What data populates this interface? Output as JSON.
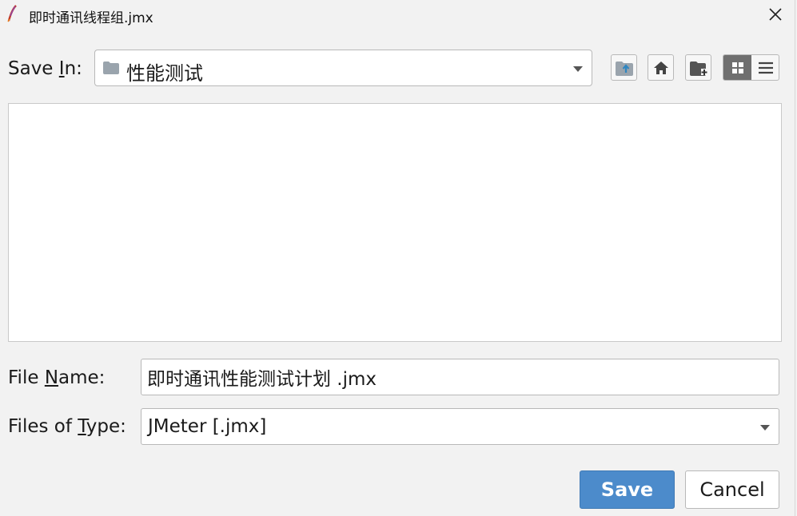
{
  "window": {
    "title": "即时通讯线程组.jmx",
    "app_icon": "feather-icon",
    "close_icon": "close-icon"
  },
  "save_in": {
    "label_prefix": "Save ",
    "label_mnemonic": "I",
    "label_suffix": "n:",
    "folder_icon": "folder-icon",
    "current": "性能测试"
  },
  "toolbar": {
    "up_folder_icon": "up-folder-icon",
    "home_icon": "home-icon",
    "new_folder_icon": "new-folder-icon",
    "list_view_icon": "grid-view-icon",
    "details_view_icon": "details-view-icon"
  },
  "file_name": {
    "label_prefix": "File ",
    "label_mnemonic": "N",
    "label_suffix": "ame:",
    "value": "即时通讯性能测试计划 .jmx"
  },
  "file_type": {
    "label_prefix": "Files of ",
    "label_mnemonic": "T",
    "label_suffix": "ype:",
    "selected": "JMeter [.jmx]"
  },
  "buttons": {
    "save": "Save",
    "cancel": "Cancel"
  },
  "colors": {
    "primary": "#4c8bcb",
    "background": "#f2f2f2"
  }
}
